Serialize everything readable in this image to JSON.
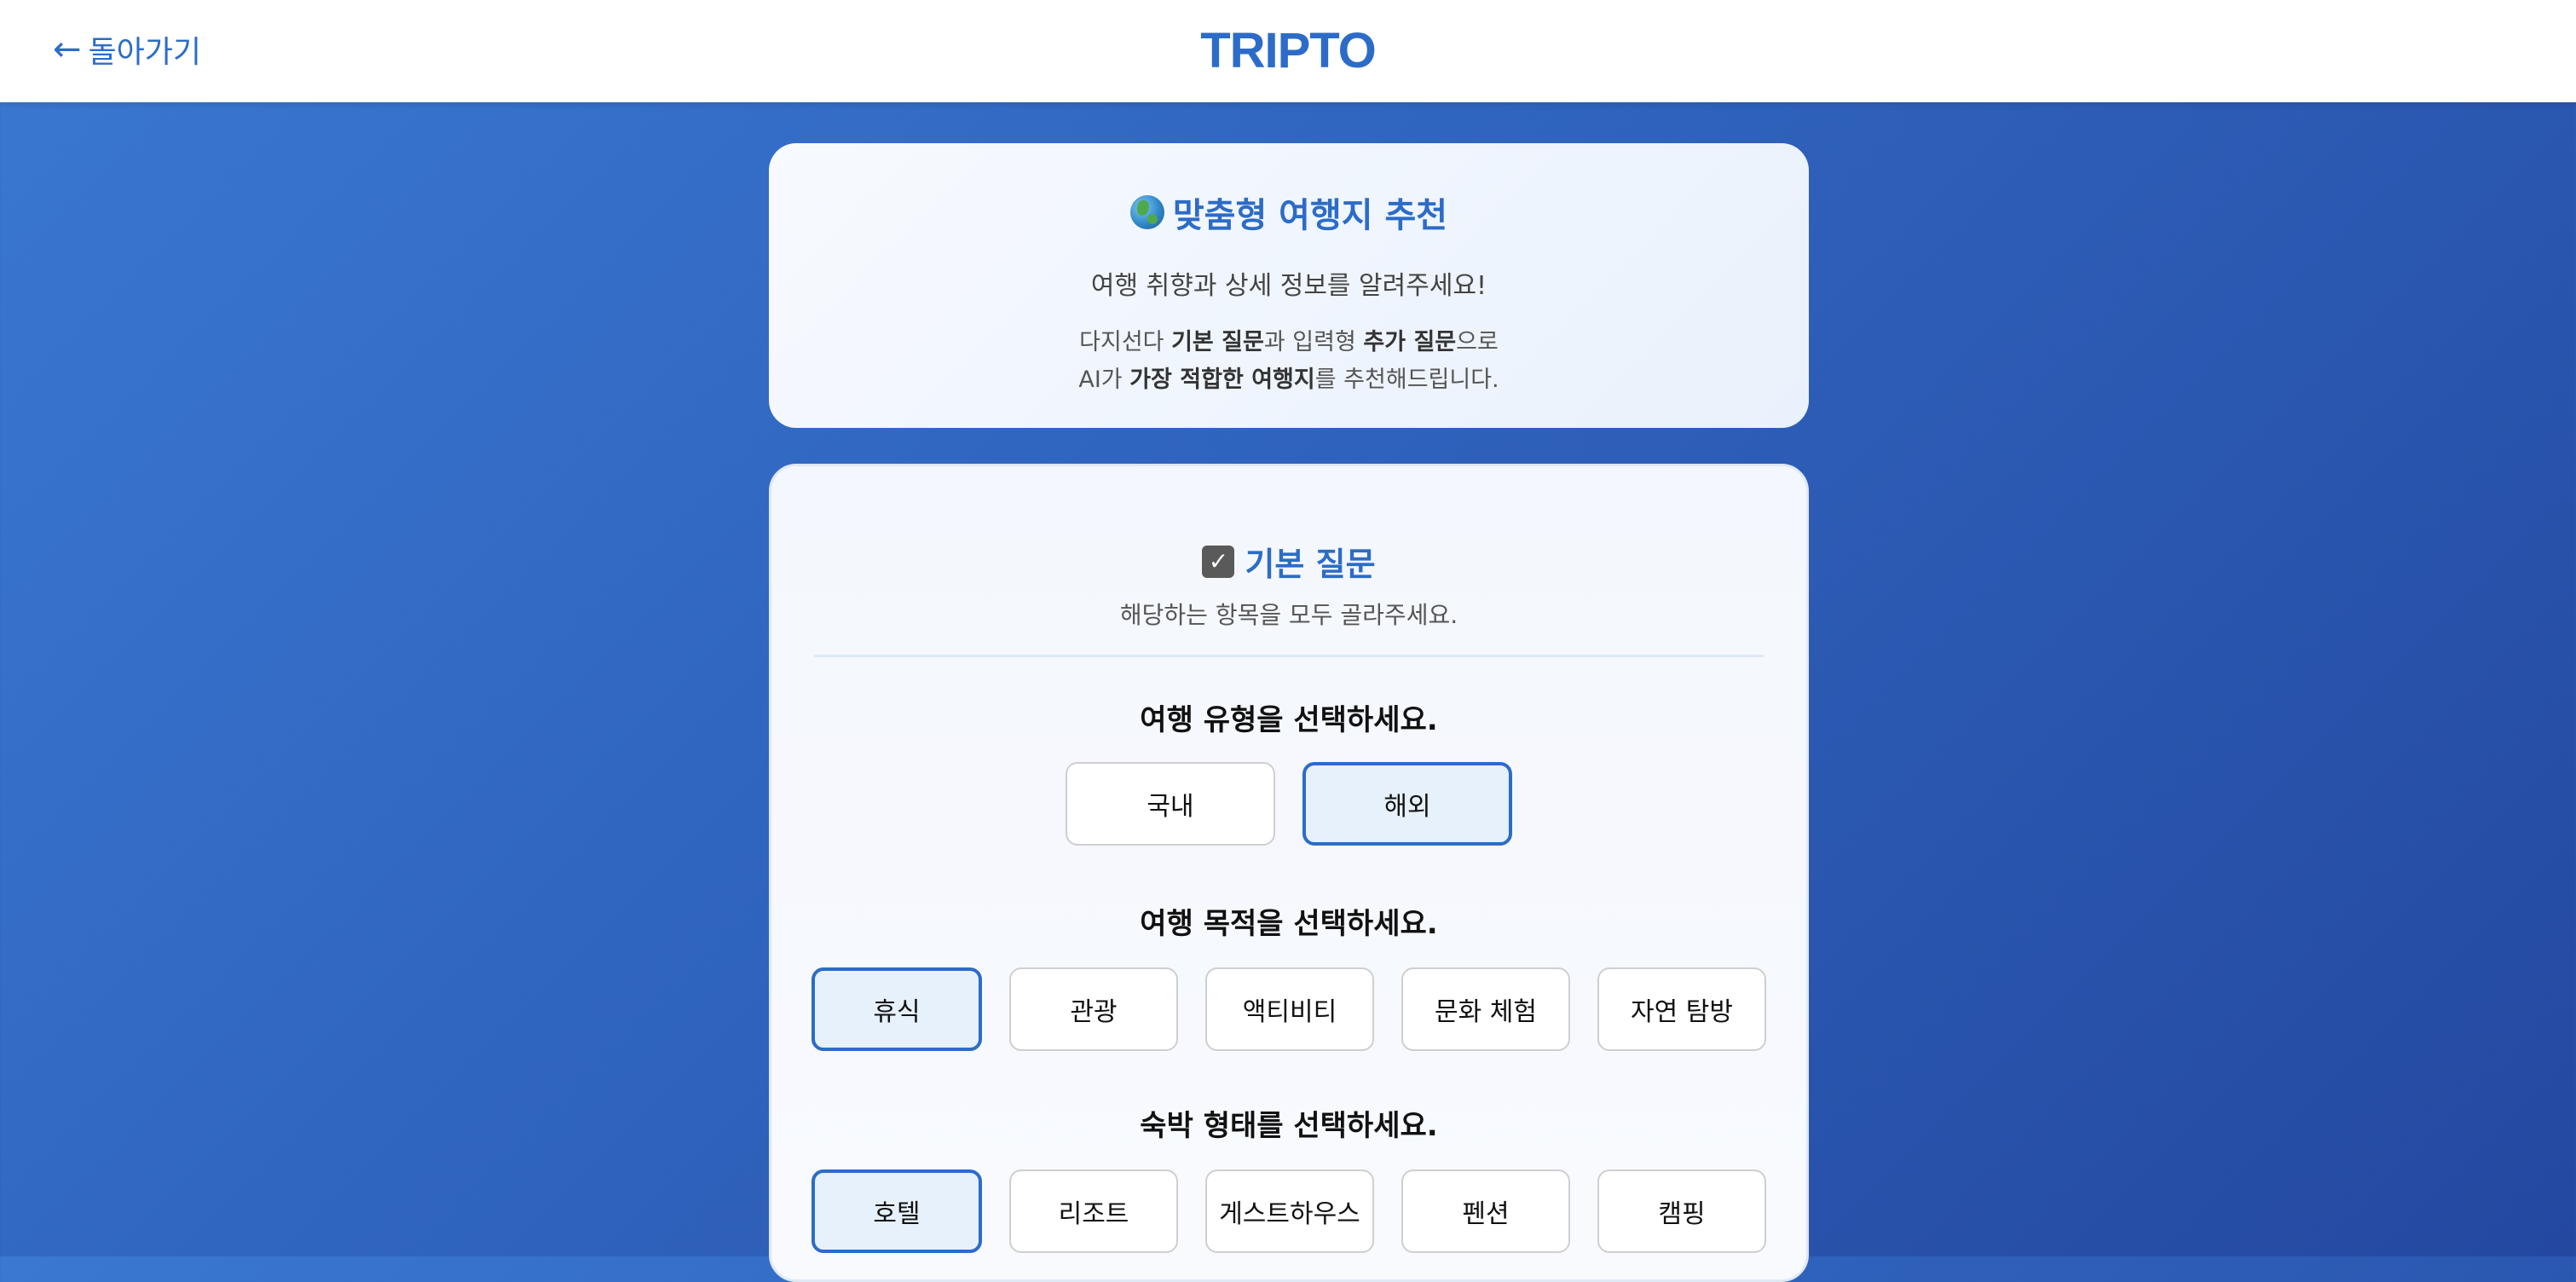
{
  "header": {
    "back_arrow": "←",
    "back_label": "돌아가기",
    "logo": "TRIPTO"
  },
  "intro": {
    "title": "맞춤형 여행지 추천",
    "subtitle": "여행 취향과 상세 정보를 알려주세요!",
    "desc_line1": [
      "다지선다 ",
      "기본 질문",
      "과 입력형 ",
      "추가 질문",
      "으로"
    ],
    "desc_line2": [
      "AI가 ",
      "가장 적합한 여행지",
      "를 추천해드립니다."
    ]
  },
  "basic": {
    "title": "기본 질문",
    "subtitle": "해당하는 항목을 모두 골라주세요.",
    "questions": [
      {
        "label": "여행 유형을 선택하세요.",
        "options": [
          {
            "label": "국내",
            "selected": false
          },
          {
            "label": "해외",
            "selected": true
          }
        ]
      },
      {
        "label": "여행 목적을 선택하세요.",
        "options": [
          {
            "label": "휴식",
            "selected": true
          },
          {
            "label": "관광",
            "selected": false
          },
          {
            "label": "액티비티",
            "selected": false
          },
          {
            "label": "문화 체험",
            "selected": false
          },
          {
            "label": "자연 탐방",
            "selected": false
          }
        ]
      },
      {
        "label": "숙박 형태를 선택하세요.",
        "options": [
          {
            "label": "호텔",
            "selected": true
          },
          {
            "label": "리조트",
            "selected": false
          },
          {
            "label": "게스트하우스",
            "selected": false
          },
          {
            "label": "펜션",
            "selected": false
          },
          {
            "label": "캠핑",
            "selected": false
          }
        ]
      }
    ]
  },
  "colors": {
    "accent": "#2c6cc8",
    "selected_bg": "#e6f1fc"
  }
}
